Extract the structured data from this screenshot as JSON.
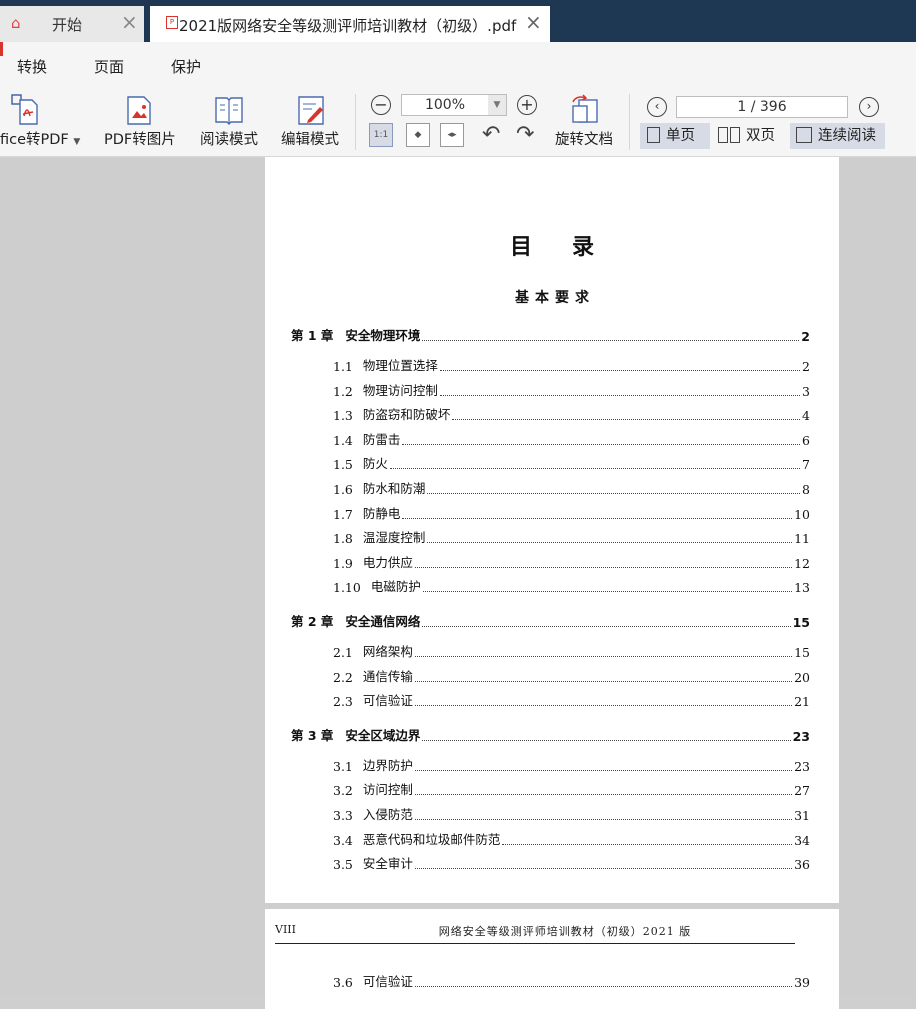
{
  "tabs": {
    "home_label": "开始",
    "doc_label": "2021版网络安全等级测评师培训教材（初级）.pdf",
    "pdf_badge": "P"
  },
  "menu": [
    "转换",
    "页面",
    "保护"
  ],
  "toolbar": {
    "office_to_pdf": "fice转PDF",
    "pdf_to_image": "PDF转图片",
    "read_mode": "阅读模式",
    "edit_mode": "编辑模式",
    "zoom": "100%",
    "rotate_doc": "旋转文档",
    "page_indicator": "1 / 396",
    "single_page": "单页",
    "double_page": "双页",
    "continuous": "连续阅读"
  },
  "document": {
    "title": "目录",
    "subtitle": "基本要求",
    "toc": [
      {
        "level": 1,
        "num": "第 1 章",
        "title": "安全物理环境",
        "page": "2"
      },
      {
        "level": 2,
        "num": "1.1",
        "title": "物理位置选择",
        "page": "2"
      },
      {
        "level": 2,
        "num": "1.2",
        "title": "物理访问控制",
        "page": "3"
      },
      {
        "level": 2,
        "num": "1.3",
        "title": "防盗窃和防破坏",
        "page": "4"
      },
      {
        "level": 2,
        "num": "1.4",
        "title": "防雷击",
        "page": "6"
      },
      {
        "level": 2,
        "num": "1.5",
        "title": "防火",
        "page": "7"
      },
      {
        "level": 2,
        "num": "1.6",
        "title": "防水和防潮",
        "page": "8"
      },
      {
        "level": 2,
        "num": "1.7",
        "title": "防静电",
        "page": "10"
      },
      {
        "level": 2,
        "num": "1.8",
        "title": "温湿度控制",
        "page": "11"
      },
      {
        "level": 2,
        "num": "1.9",
        "title": "电力供应",
        "page": "12"
      },
      {
        "level": 2,
        "num": "1.10",
        "title": "电磁防护",
        "page": "13"
      },
      {
        "level": 1,
        "num": "第 2 章",
        "title": "安全通信网络",
        "page": "15"
      },
      {
        "level": 2,
        "num": "2.1",
        "title": "网络架构",
        "page": "15"
      },
      {
        "level": 2,
        "num": "2.2",
        "title": "通信传输",
        "page": "20"
      },
      {
        "level": 2,
        "num": "2.3",
        "title": "可信验证",
        "page": "21"
      },
      {
        "level": 1,
        "num": "第 3 章",
        "title": "安全区域边界",
        "page": "23"
      },
      {
        "level": 2,
        "num": "3.1",
        "title": "边界防护",
        "page": "23"
      },
      {
        "level": 2,
        "num": "3.2",
        "title": "访问控制",
        "page": "27"
      },
      {
        "level": 2,
        "num": "3.3",
        "title": "入侵防范",
        "page": "31"
      },
      {
        "level": 2,
        "num": "3.4",
        "title": "恶意代码和垃圾邮件防范",
        "page": "34"
      },
      {
        "level": 2,
        "num": "3.5",
        "title": "安全审计",
        "page": "36"
      }
    ],
    "page2": {
      "roman": "VIII",
      "header": "网络安全等级测评师培训教材（初级）2021 版",
      "toc": [
        {
          "level": 2,
          "num": "3.6",
          "title": "可信验证",
          "page": "39"
        }
      ]
    }
  },
  "colors": {
    "tab_bar": "#1e3752",
    "accent_red": "#d9342b",
    "active_mode": "#d6dbe6"
  }
}
